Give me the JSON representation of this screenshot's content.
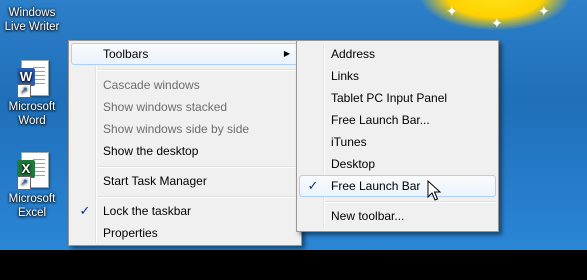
{
  "desktop": {
    "icons": [
      {
        "name": "Windows Live Writer",
        "line1": "Windows",
        "line2": "Live Writer"
      },
      {
        "name": "Microsoft Word",
        "line1": "Microsoft",
        "line2": "Word",
        "badge": "W"
      },
      {
        "name": "Microsoft Excel",
        "line1": "Microsoft",
        "line2": "Excel",
        "badge": "X"
      }
    ]
  },
  "taskbar_menu": {
    "items": [
      {
        "label": "Toolbars",
        "has_submenu": true
      },
      {
        "label": "Cascade windows",
        "disabled": true
      },
      {
        "label": "Show windows stacked",
        "disabled": true
      },
      {
        "label": "Show windows side by side",
        "disabled": true
      },
      {
        "label": "Show the desktop"
      },
      {
        "label": "Start Task Manager"
      },
      {
        "label": "Lock the taskbar",
        "checked": true
      },
      {
        "label": "Properties"
      }
    ]
  },
  "toolbars_submenu": {
    "items": [
      {
        "label": "Address"
      },
      {
        "label": "Links"
      },
      {
        "label": "Tablet PC Input Panel"
      },
      {
        "label": "Free Launch Bar..."
      },
      {
        "label": "iTunes"
      },
      {
        "label": "Desktop"
      },
      {
        "label": "Free Launch Bar",
        "checked": true,
        "highlighted": true
      },
      {
        "label": "New toolbar..."
      }
    ]
  },
  "glyphs": {
    "check": "✓",
    "submenu_arrow": "▶",
    "shortcut_arrow": "↗",
    "sparkle": "✦"
  },
  "colors": {
    "menu_bg": "#f0f0f0",
    "hover_border": "#aecff7",
    "disabled_text": "#6d6d6d"
  }
}
